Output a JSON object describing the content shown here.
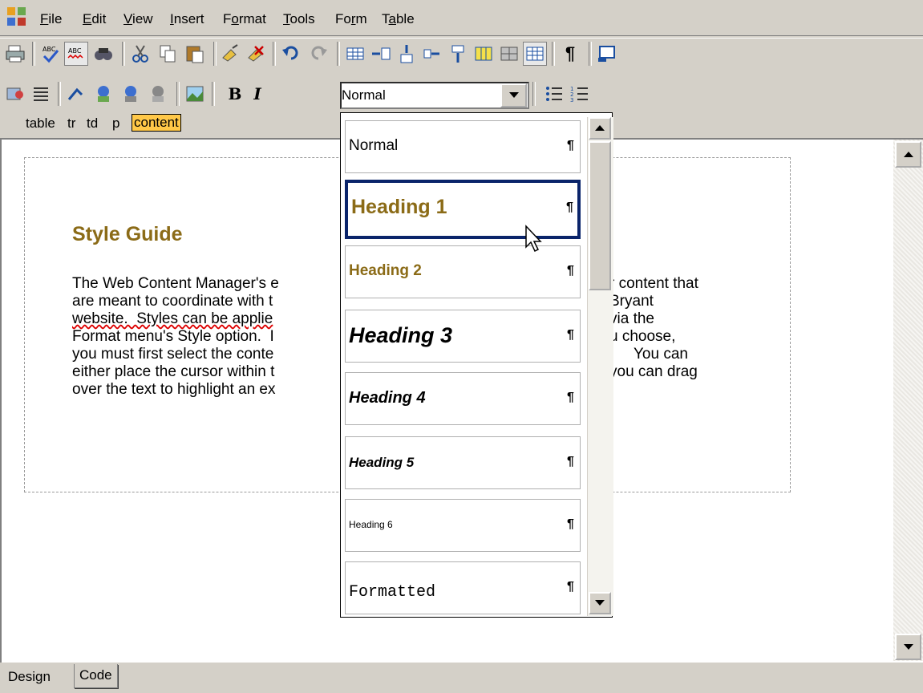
{
  "menubar": {
    "items": [
      "File",
      "Edit",
      "View",
      "Insert",
      "Format",
      "Tools",
      "Form",
      "Table"
    ],
    "mnemonics": [
      "F",
      "E",
      "V",
      "I",
      "o",
      "T",
      "r",
      "a"
    ]
  },
  "toolbar1": {
    "icons": [
      "print-icon",
      "spellcheck-icon",
      "check-spelling-as-you-type-icon",
      "find-icon",
      "cut-icon",
      "copy-icon",
      "paste-icon",
      "clean-icon",
      "remove-format-icon",
      "undo-icon",
      "redo-icon",
      "insert-table-icon",
      "insert-row-icon",
      "insert-column-icon",
      "merge-cells-icon",
      "split-cells-icon",
      "table-properties-icon",
      "cell-properties-icon",
      "show-borders-icon",
      "show-paragraph-marks-icon",
      "preview-icon"
    ]
  },
  "toolbar2": {
    "bold_label": "B",
    "italic_label": "I",
    "style_value": "Normal"
  },
  "breadcrumb": {
    "items": [
      "table",
      "tr",
      "td",
      "p",
      "content"
    ]
  },
  "document": {
    "title": "Style Guide",
    "lines": [
      "The Web Content Manager's e",
      "are meant to coordinate with t",
      "website.  Styles can be applie",
      "Format menu's Style option.  I",
      "you must first select the conte",
      "either place the cursor within t",
      "over the text to highlight an ex"
    ],
    "lines_right": [
      "r content that",
      "Bryant",
      "via the",
      "u choose,",
      "You can",
      "you can drag",
      ""
    ]
  },
  "style_list": {
    "options": [
      "Normal",
      "Heading 1",
      "Heading 2",
      "Heading 3",
      "Heading 4",
      "Heading 5",
      "Heading 6",
      "Formatted"
    ],
    "paragraph_mark": "¶",
    "highlighted": "Heading 1"
  },
  "tabs": {
    "design": "Design",
    "code": "Code"
  },
  "colors": {
    "heading": "#8b6b17",
    "highlight_border": "#0a246a",
    "breadcrumb_selected": "#ffc848"
  }
}
